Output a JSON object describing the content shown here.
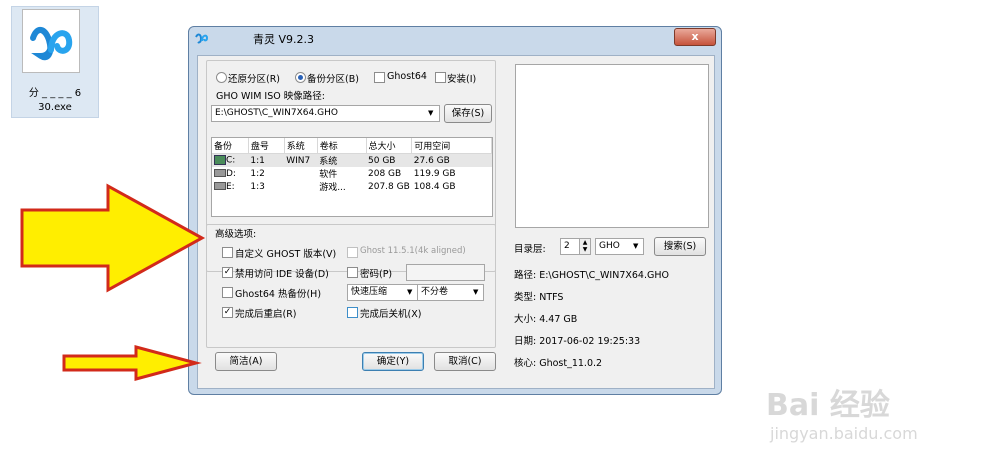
{
  "desktop_icon": {
    "line1": "分 _ _ _ _ 6",
    "line2": "30.exe"
  },
  "window": {
    "title": "青灵 V9.2.3",
    "close_glyph": "x",
    "mode_options": [
      "还原分区(R)",
      "备份分区(B)",
      "Ghost64",
      "安装(I)"
    ],
    "path_label": "GHO WIM ISO 映像路径:",
    "path_value": "E:\\GHOST\\C_WIN7X64.GHO",
    "save_button": "保存(S)",
    "table": {
      "headers": [
        "备份",
        "盘号",
        "系统",
        "卷标",
        "总大小",
        "可用空间"
      ],
      "rows": [
        [
          "C:",
          "1:1",
          "WIN7",
          "系统",
          "50 GB",
          "27.6 GB"
        ],
        [
          "D:",
          "1:2",
          "",
          "软件",
          "208 GB",
          "119.9 GB"
        ],
        [
          "E:",
          "1:3",
          "",
          "游戏...",
          "207.8 GB",
          "108.4 GB"
        ]
      ]
    },
    "advanced": {
      "title": "高级选项:",
      "custom_ghost": "自定义 GHOST 版本(V)",
      "ghost_version": "Ghost 11.5.1(4k aligned)",
      "disable_ide": "禁用访问 IDE 设备(D)",
      "password": "密码(P)",
      "ghost64_hot": "Ghost64 热备份(H)",
      "compress": "快速压缩",
      "split": "不分卷",
      "reboot": "完成后重启(R)",
      "shutdown": "完成后关机(X)"
    },
    "simple_button": "简洁(A)",
    "ok_button": "确定(Y)",
    "cancel_button": "取消(C)",
    "dir_label": "目录层:",
    "dir_value": "2",
    "type_value": "GHO",
    "search_button": "搜索(S)",
    "info": {
      "path": "路径: E:\\GHOST\\C_WIN7X64.GHO",
      "type": "类型: NTFS",
      "size": "大小: 4.47 GB",
      "date": "日期: 2017-06-02  19:25:33",
      "core": "核心: Ghost_11.0.2"
    }
  },
  "watermark": {
    "logo": "Bai 经验",
    "url": "jingyan.baidu.com"
  },
  "colors": {
    "arrow_fill": "#ffee00",
    "arrow_stroke": "#d22a1a",
    "window_frame": "#c9d9ea"
  }
}
